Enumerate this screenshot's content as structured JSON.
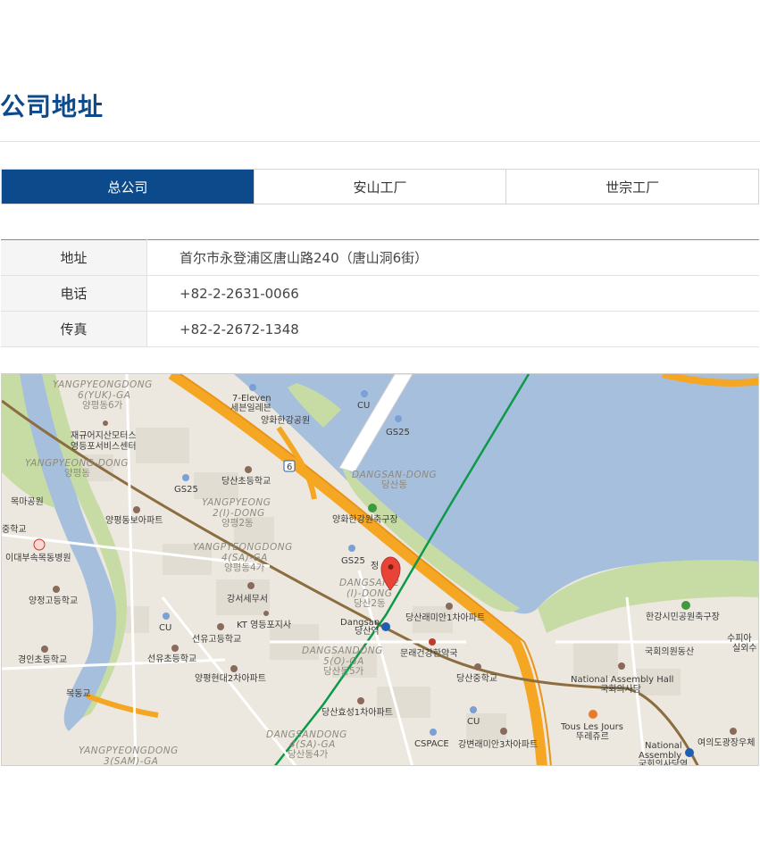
{
  "page": {
    "title": "公司地址"
  },
  "tabs": [
    {
      "label": "总公司",
      "active": true
    },
    {
      "label": "安山工厂",
      "active": false
    },
    {
      "label": "世宗工厂",
      "active": false
    }
  ],
  "info": {
    "address_label": "地址",
    "address_value": "首尔市永登浦区唐山路240（唐山洞6街）",
    "phone_label": "电话",
    "phone_value": "+82-2-2631-0066",
    "fax_label": "传真",
    "fax_value": "+82-2-2672-1348"
  },
  "map": {
    "colors": {
      "water": "#a5bfdd",
      "land": "#ece8df",
      "park": "#c6dca4",
      "highway": "#f5a623",
      "subway_green": "#0c9a4a",
      "marker": "#e84336"
    },
    "labels": {
      "yangpyeong6_en": "YANGPYEONGDONG",
      "yangpyeong6_en2": "6(YUK)-GA",
      "yangpyeong6_ko": "양평동6가",
      "seven_eleven": "7-Eleven",
      "seven_eleven_ko": "세븐일레븐",
      "yanghwa_park": "양화한강공원",
      "cu1": "CU",
      "gs25_1": "GS25",
      "jaegyu": "재규어지산모터스",
      "yeongdeungpo_service": "영등포서비스센터",
      "yangpyeong_dong_en": "YANGPYEONG-DONG",
      "yangpyeong_dong_ko": "양평동",
      "route6": "6",
      "dangsan_dong_en": "DANGSAN-DONG",
      "dangsan_dong_ko": "당산동",
      "dangsan_elem": "당산초등학교",
      "gs25_2": "GS25",
      "yangpyeong2_en": "YANGPYEONG",
      "yangpyeong2_en2": "2(I)-DONG",
      "yangpyeong2_ko": "양평2동",
      "mokma_park": "목마공원",
      "yangpyeong_bora": "양평동보아파트",
      "yanghwa_soccer": "양화한강원축구장",
      "school_left": "중학교",
      "ewha_hospital": "이대부속목동병원",
      "yangpyeong4_en": "YANGPYEONGDONG",
      "yangpyeong4_en2": "4(SA)-GA",
      "yangpyeong4_ko": "양평동4가",
      "gs25_3": "GS25",
      "jeong": "정",
      "dangsan2_en": "DANGSAN 2",
      "dangsan2_en2": "(I)-DONG",
      "dangsan2_ko": "당산2동",
      "yangjeong_high": "양정고등학교",
      "gangseo_tax": "강서세무서",
      "kt_post": "KT 영등포지사",
      "cu2": "CU",
      "dangsan_station_en": "Dangsan",
      "dangsan_station_ko": "당산역",
      "raemian1": "당산래미안1차아파트",
      "hangang_soccer": "한강시민공원축구장",
      "seonyu_high": "선유고등학교",
      "gyeongin_elem": "경인초등학교",
      "seonyu_elem": "선유초등학교",
      "dangsan5_en": "DANGSANDONG",
      "dangsan5_en2": "5(O)-GA",
      "dangsan5_ko": "당산동5가",
      "munrae_pharmacy": "문래건강한약국",
      "assembly_lib": "국회의원동산",
      "suppia": "수피아",
      "silwoe": "실외수",
      "yangpyeong_hyundai": "양평현대2차아파트",
      "dangsan_middle": "당산중학교",
      "assembly_hall_en": "National Assembly Hall",
      "assembly_hall_ko": "국회의사당",
      "mokdong_bridge": "목동교",
      "dangsan_hyosung": "당산효성1차아파트",
      "cu3": "CU",
      "tous_les_jours": "Tous Les Jours",
      "tous_les_jours_ko": "뚜레쥬르",
      "yeouido_post": "여의도광장우체",
      "dangsan4_en": "DANGSANDONG",
      "dangsan4_en2": "4(SA)-GA",
      "dangsan4_ko": "당산동4가",
      "cspace": "CSPACE",
      "raemian3": "강변래미안3차아파트",
      "national_assembly_en": "National",
      "national_assembly_en2": "Assembly",
      "national_assembly_ko": "국회의사당역",
      "yangpyeong3_en": "YANGPYEONGDONG",
      "yangpyeong3_en2": "3(SAM)-GA"
    }
  }
}
